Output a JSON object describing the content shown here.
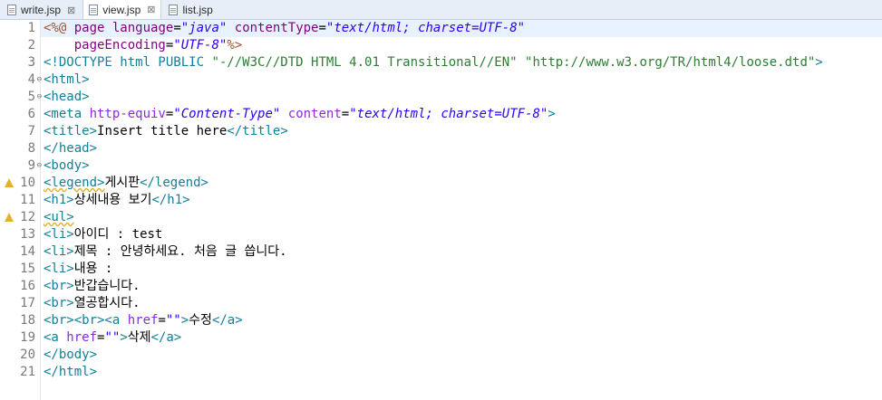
{
  "tabs": [
    {
      "label": "write.jsp",
      "active": false,
      "close": "⊠"
    },
    {
      "label": "view.jsp",
      "active": true,
      "close": "⊠"
    },
    {
      "label": "list.jsp",
      "active": false,
      "close": ""
    }
  ],
  "lines": [
    {
      "n": "1",
      "segs": [
        [
          "dir",
          "<%@ "
        ],
        [
          "jattr",
          "page "
        ],
        [
          "jattr",
          "language"
        ],
        [
          "txt",
          "="
        ],
        [
          "str",
          "\"java\""
        ],
        [
          "txt",
          " "
        ],
        [
          "jattr",
          "contentType"
        ],
        [
          "txt",
          "="
        ],
        [
          "str",
          "\"text/html; charset=UTF-8\""
        ]
      ]
    },
    {
      "n": "2",
      "segs": [
        [
          "txt",
          "    "
        ],
        [
          "jattr",
          "pageEncoding"
        ],
        [
          "txt",
          "="
        ],
        [
          "str",
          "\"UTF-8\""
        ],
        [
          "dir",
          "%>"
        ]
      ]
    },
    {
      "n": "3",
      "segs": [
        [
          "doctype",
          "<!DOCTYPE html PUBLIC "
        ],
        [
          "dtlit",
          "\"-//W3C//DTD HTML 4.01 Transitional//EN\""
        ],
        [
          "txt",
          " "
        ],
        [
          "dtlit",
          "\"http://www.w3.org/TR/html4/loose.dtd\""
        ],
        [
          "doctype",
          ">"
        ]
      ]
    },
    {
      "n": "4",
      "fold": true,
      "segs": [
        [
          "tag",
          "<html>"
        ]
      ]
    },
    {
      "n": "5",
      "fold": true,
      "segs": [
        [
          "tag",
          "<head>"
        ]
      ]
    },
    {
      "n": "6",
      "segs": [
        [
          "tag",
          "<meta "
        ],
        [
          "attr",
          "http-equiv"
        ],
        [
          "txt",
          "="
        ],
        [
          "str",
          "\"Content-Type\""
        ],
        [
          "txt",
          " "
        ],
        [
          "attr",
          "content"
        ],
        [
          "txt",
          "="
        ],
        [
          "str",
          "\"text/html; charset=UTF-8\""
        ],
        [
          "tag",
          ">"
        ]
      ]
    },
    {
      "n": "7",
      "segs": [
        [
          "tag",
          "<title>"
        ],
        [
          "txt",
          "Insert title here"
        ],
        [
          "tag",
          "</title>"
        ]
      ]
    },
    {
      "n": "8",
      "segs": [
        [
          "tag",
          "</head>"
        ]
      ]
    },
    {
      "n": "9",
      "fold": true,
      "segs": [
        [
          "tag",
          "<body>"
        ]
      ]
    },
    {
      "n": "10",
      "warn": true,
      "segs": [
        [
          "tag squig",
          "<legend>"
        ],
        [
          "txt",
          "게시판"
        ],
        [
          "tag",
          "</legend>"
        ]
      ]
    },
    {
      "n": "11",
      "segs": [
        [
          "tag",
          "<h1>"
        ],
        [
          "txt",
          "상세내용 보기"
        ],
        [
          "tag",
          "</h1>"
        ]
      ]
    },
    {
      "n": "12",
      "warn": true,
      "segs": [
        [
          "tag squig",
          "<ul>"
        ]
      ]
    },
    {
      "n": "13",
      "segs": [
        [
          "tag",
          "<li>"
        ],
        [
          "txt",
          "아이디 : test"
        ]
      ]
    },
    {
      "n": "14",
      "segs": [
        [
          "tag",
          "<li>"
        ],
        [
          "txt",
          "제목 : 안녕하세요. 처음 글 씁니다."
        ]
      ]
    },
    {
      "n": "15",
      "segs": [
        [
          "tag",
          "<li>"
        ],
        [
          "txt",
          "내용 :"
        ]
      ]
    },
    {
      "n": "16",
      "segs": [
        [
          "tag",
          "<br>"
        ],
        [
          "txt",
          "반갑습니다."
        ]
      ]
    },
    {
      "n": "17",
      "segs": [
        [
          "tag",
          "<br>"
        ],
        [
          "txt",
          "열공합시다."
        ]
      ]
    },
    {
      "n": "18",
      "segs": [
        [
          "tag",
          "<br><br><a "
        ],
        [
          "attr",
          "href"
        ],
        [
          "txt",
          "="
        ],
        [
          "str",
          "\"\""
        ],
        [
          "tag",
          ">"
        ],
        [
          "txt",
          "수정"
        ],
        [
          "tag",
          "</a>"
        ]
      ]
    },
    {
      "n": "19",
      "segs": [
        [
          "tag",
          "<a "
        ],
        [
          "attr",
          "href"
        ],
        [
          "txt",
          "="
        ],
        [
          "str",
          "\"\""
        ],
        [
          "tag",
          ">"
        ],
        [
          "txt",
          "삭제"
        ],
        [
          "tag",
          "</a>"
        ]
      ]
    },
    {
      "n": "20",
      "segs": [
        [
          "tag",
          "</body>"
        ]
      ]
    },
    {
      "n": "21",
      "segs": [
        [
          "tag",
          "</html>"
        ]
      ]
    }
  ],
  "current_line": 1,
  "colors": {
    "tag": "#11809a",
    "string": "#2a00ff",
    "warning": "#e2b32a"
  }
}
